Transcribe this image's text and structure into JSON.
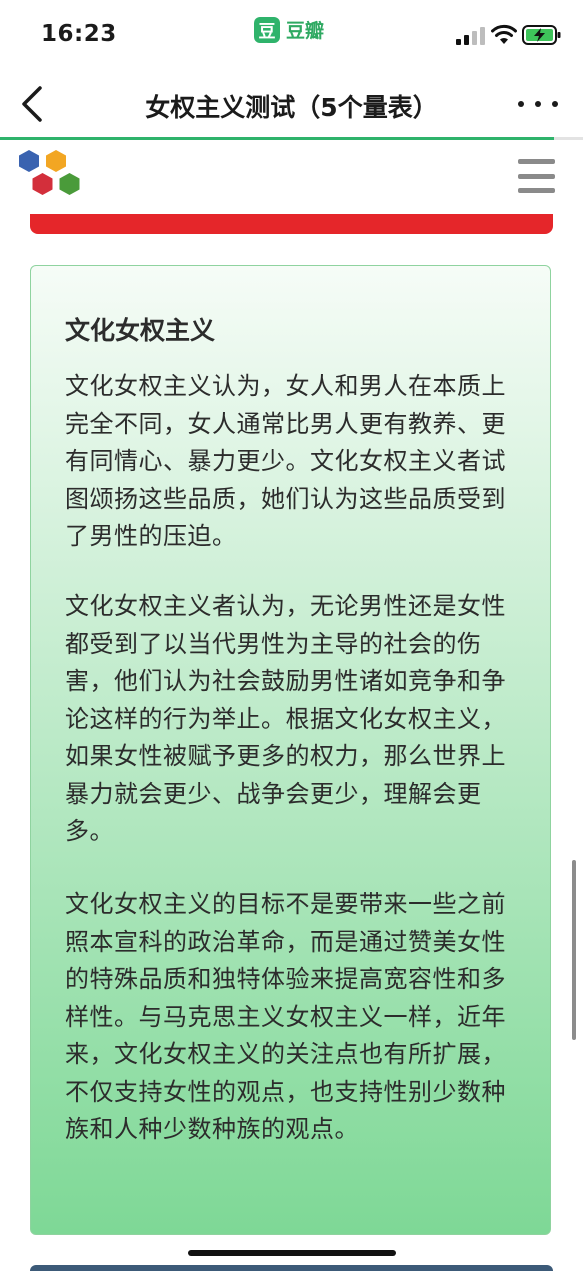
{
  "status_bar": {
    "time": "16:23",
    "app_icon_glyph": "豆",
    "app_name": "豆瓣",
    "icons": [
      "signal-icon",
      "wifi-icon",
      "battery-charging-icon"
    ]
  },
  "nav": {
    "title": "女权主义测试（5个量表）",
    "back_icon": "chevron-left-icon",
    "more_icon": "more-horizontal-icon",
    "progress_fraction": 0.95
  },
  "site_header": {
    "logo_icon": "hexagon-cluster-logo",
    "menu_icon": "hamburger-menu-icon"
  },
  "colors": {
    "accent_green": "#2fb36b",
    "red_bar": "#e5262a",
    "card_border": "#8fd39f"
  },
  "card": {
    "title": "文化女权主义",
    "paragraphs": [
      "文化女权主义认为，女人和男人在本质上完全不同，女人通常比男人更有教养、更有同情心、暴力更少。文化女权主义者试图颂扬这些品质，她们认为这些品质受到了男性的压迫。",
      "文化女权主义者认为，无论男性还是女性都受到了以当代男性为主导的社会的伤害，他们认为社会鼓励男性诸如竞争和争论这样的行为举止。根据文化女权主义，如果女性被赋予更多的权力，那么世界上暴力就会更少、战争会更少，理解会更多。",
      "文化女权主义的目标不是要带来一些之前照本宣科的政治革命，而是通过赞美女性的特殊品质和独特体验来提高宽容性和多样性。与马克思主义女权主义一样，近年来，文化女权主义的关注点也有所扩展，不仅支持女性的观点，也支持性别少数种族和人种少数种族的观点。"
    ]
  }
}
